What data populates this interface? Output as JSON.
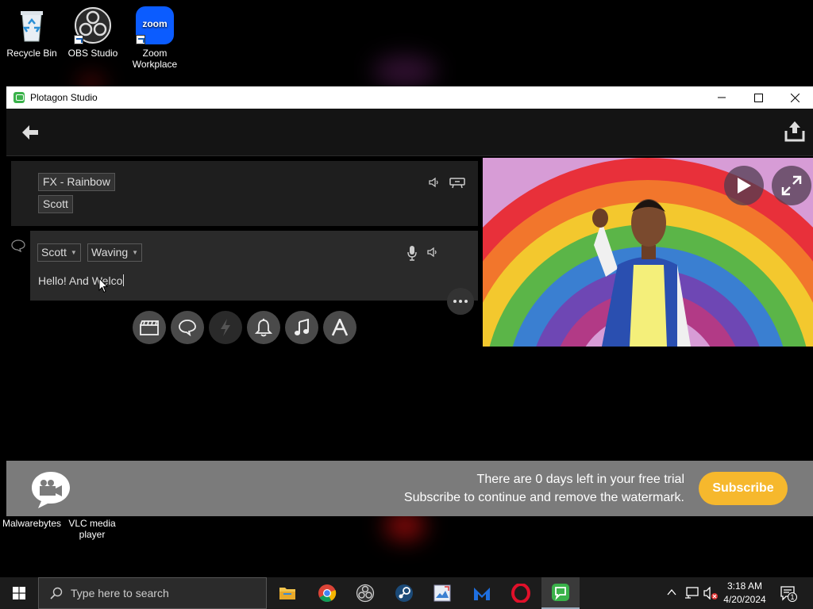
{
  "desktop": {
    "icons": [
      {
        "label": "Recycle Bin"
      },
      {
        "label": "OBS Studio"
      },
      {
        "label": "Zoom Workplace",
        "logo_text": "zoom"
      },
      {
        "label": "Malwarebytes"
      },
      {
        "label": "VLC media player"
      }
    ]
  },
  "window": {
    "title": "Plotagon Studio",
    "controls": {
      "minimize": "minimize",
      "maximize": "maximize",
      "close": "close"
    }
  },
  "scene": {
    "fx_chip": "FX - Rainbow",
    "character_chip": "Scott"
  },
  "dialog": {
    "character": "Scott",
    "emotion": "Waving",
    "typed_text": "Hello! And Welco"
  },
  "add_buttons": [
    {
      "icon": "clapperboard-icon"
    },
    {
      "icon": "speech-bubble-icon"
    },
    {
      "icon": "lightning-icon",
      "disabled": true
    },
    {
      "icon": "bell-icon"
    },
    {
      "icon": "music-note-icon"
    },
    {
      "icon": "text-icon"
    }
  ],
  "trial_banner": {
    "line1": "There are 0 days left in your free trial",
    "line2": "Subscribe to continue and remove the watermark.",
    "subscribe_label": "Subscribe"
  },
  "taskbar": {
    "search_placeholder": "Type here to search",
    "time": "3:18 AM",
    "date": "4/20/2024",
    "notification_count": "1"
  },
  "colors": {
    "accent_yellow": "#f6b82d",
    "plotagon_green": "#3ab24a",
    "banner_gray": "#7b7b7b"
  }
}
